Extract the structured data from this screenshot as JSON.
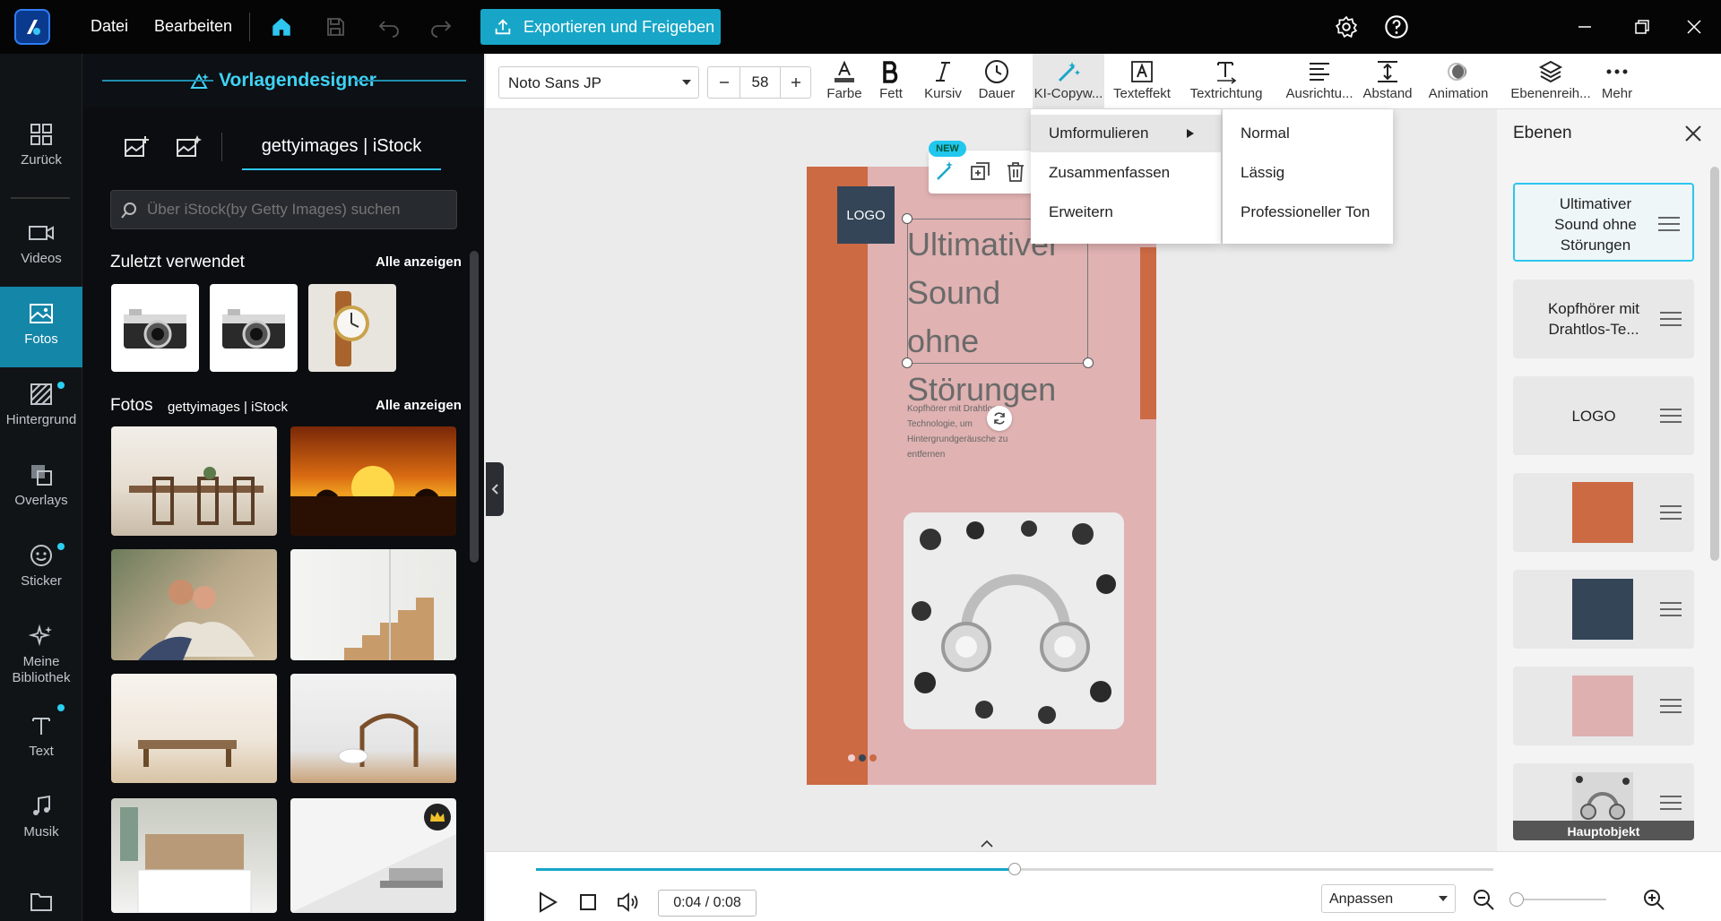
{
  "topbar": {
    "menu_file": "Datei",
    "menu_edit": "Bearbeiten",
    "export_label": "Exportieren und Freigeben"
  },
  "panel": {
    "title": "Vorlagendesigner",
    "provider_tab": "gettyimages | iStock",
    "search_placeholder": "Über iStock(by Getty Images) suchen",
    "recent_title": "Zuletzt verwendet",
    "recent_show_all": "Alle anzeigen",
    "photos_title": "Fotos",
    "photos_provider": "gettyimages | iStock",
    "photos_show_all": "Alle anzeigen"
  },
  "rail": [
    {
      "label": "Zurück",
      "icon": "grid-icon"
    },
    {
      "label": "Videos",
      "icon": "video-icon"
    },
    {
      "label": "Fotos",
      "icon": "photo-icon",
      "active": true
    },
    {
      "label": "Hintergrund",
      "icon": "background-icon",
      "dot": true
    },
    {
      "label": "Overlays",
      "icon": "overlay-icon"
    },
    {
      "label": "Sticker",
      "icon": "sticker-icon",
      "dot": true
    },
    {
      "label": "Meine Bibliothek",
      "icon": "sparkle-icon"
    },
    {
      "label": "Text",
      "icon": "text-icon",
      "dot": true
    },
    {
      "label": "Musik",
      "icon": "music-icon"
    }
  ],
  "toolbar": {
    "font": "Noto Sans JP",
    "font_size": "58",
    "items": [
      {
        "label": "Farbe",
        "icon": "color-icon"
      },
      {
        "label": "Fett",
        "icon": "bold-icon"
      },
      {
        "label": "Kursiv",
        "icon": "italic-icon"
      },
      {
        "label": "Dauer",
        "icon": "clock-icon"
      },
      {
        "label": "KI-Copyw...",
        "icon": "magic-wand-icon"
      },
      {
        "label": "Texteffekt",
        "icon": "text-effect-icon"
      },
      {
        "label": "Textrichtung",
        "icon": "text-direction-icon"
      },
      {
        "label": "Ausrichtu...",
        "icon": "align-icon"
      },
      {
        "label": "Abstand",
        "icon": "spacing-icon"
      },
      {
        "label": "Animation",
        "icon": "animation-icon"
      },
      {
        "label": "Ebenenreih...",
        "icon": "layers-icon"
      },
      {
        "label": "Mehr",
        "icon": "more-icon"
      }
    ]
  },
  "ai_menu": [
    "Umformulieren",
    "Zusammenfassen",
    "Erweitern"
  ],
  "ai_submenu": [
    "Normal",
    "Lässig",
    "Professioneller Ton"
  ],
  "canvas": {
    "new_badge": "NEW",
    "logo": "LOGO",
    "headline": "Ultimativer Sound ohne Störungen",
    "body": "Kopfhörer mit Drahtlos-Technologie, um Hintergrundgeräusche zu entfernen"
  },
  "layers": {
    "title": "Ebenen",
    "items": [
      {
        "text": "Ultimativer Sound ohne Störungen"
      },
      {
        "text": "Kopfhörer mit Drahtlos-Te..."
      },
      {
        "text": "LOGO"
      },
      {
        "swatch": "#cc6a43"
      },
      {
        "swatch": "#344558"
      },
      {
        "swatch": "#dfb0b0"
      },
      {
        "badge": "Hauptobjekt"
      }
    ]
  },
  "playback": {
    "time": "0:04 / 0:08",
    "progress": 0.5,
    "zoom_label": "Anpassen"
  }
}
